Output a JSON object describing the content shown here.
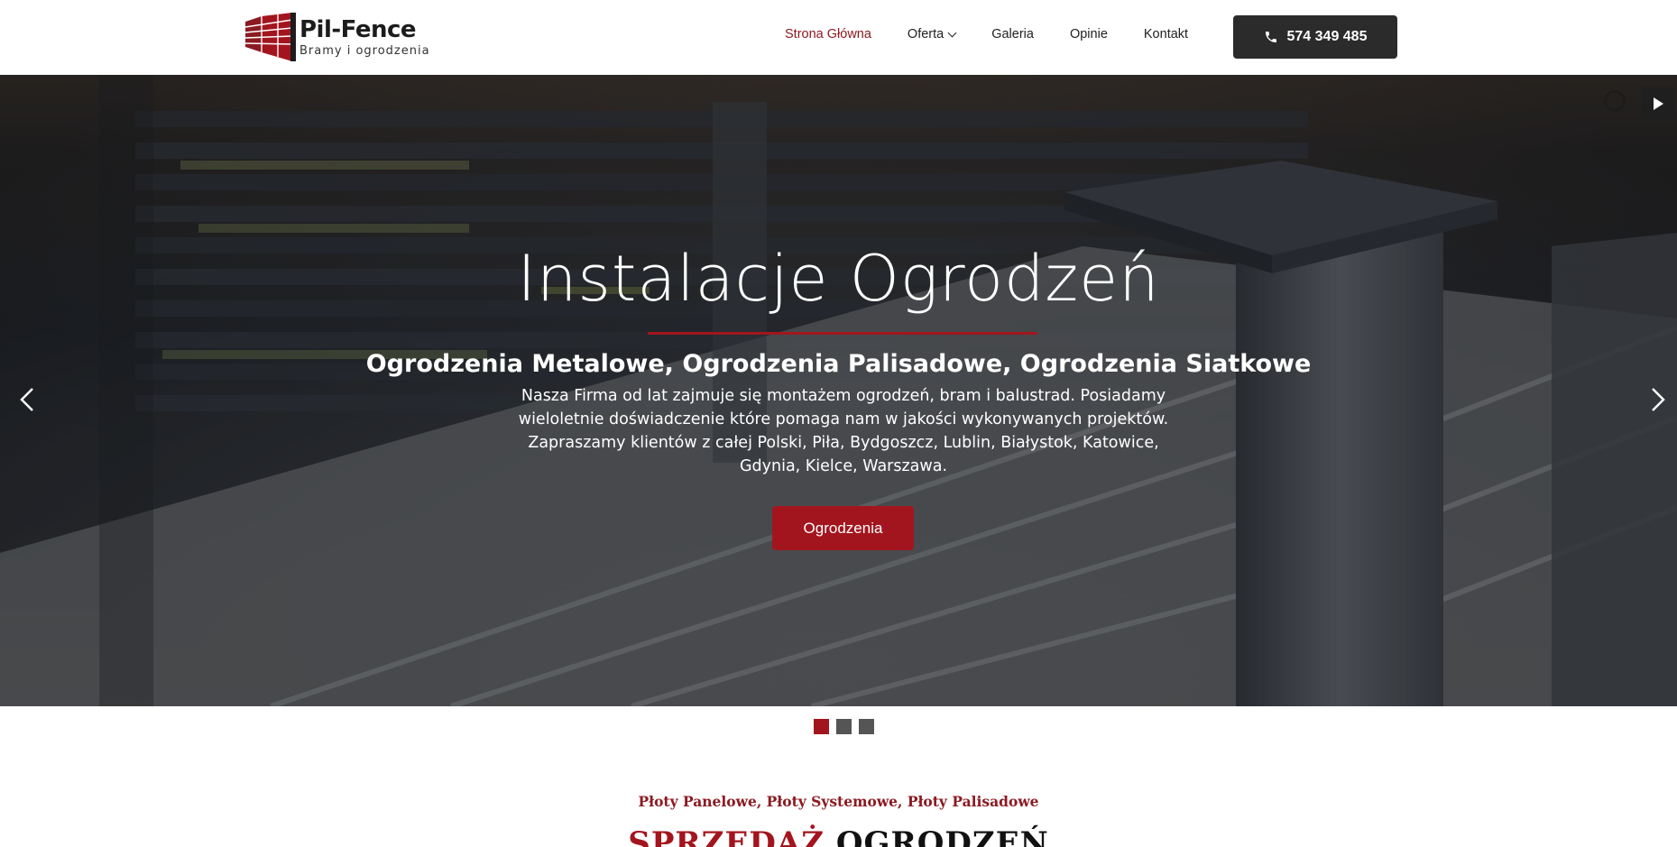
{
  "brand": {
    "name": "Pil-Fence",
    "tagline": "Bramy i ogrodzenia",
    "logo_icon": "fence-logo-icon",
    "color_primary": "#a3151e",
    "color_dark": "#2b2b2b"
  },
  "nav": {
    "items": [
      {
        "label": "Strona Główna",
        "active": true
      },
      {
        "label": "Oferta",
        "has_dropdown": true
      },
      {
        "label": "Galeria"
      },
      {
        "label": "Opinie"
      },
      {
        "label": "Kontakt"
      }
    ],
    "phone": "574 349 485",
    "phone_icon": "phone-icon"
  },
  "hero": {
    "title": "Instalacje Ogrodzeń",
    "subtitle": "Ogrodzenia Metalowe, Ogrodzenia Palisadowe, Ogrodzenia Siatkowe",
    "description": "Nasza Firma od lat zajmuje się montażem ogrodzeń, bram i balustrad. Posiadamy wieloletnie doświadczenie które pomaga nam w jakości wykonywanych projektów. Zapraszamy klientów z całej Polski, Piła, Bydgoszcz, Lublin, Białystok, Katowice, Gdynia, Kielce, Warszawa.",
    "cta": "Ogrodzenia",
    "prev_icon": "chevron-left-icon",
    "next_icon": "chevron-right-icon",
    "slides_count": 3,
    "active_slide": 1
  },
  "section": {
    "eyebrow": "Płoty Panelowe, Płoty Systemowe, Płoty Palisadowe",
    "title_highlight": "SPRZEDAŻ",
    "title_rest": " OGRODZEŃ"
  }
}
